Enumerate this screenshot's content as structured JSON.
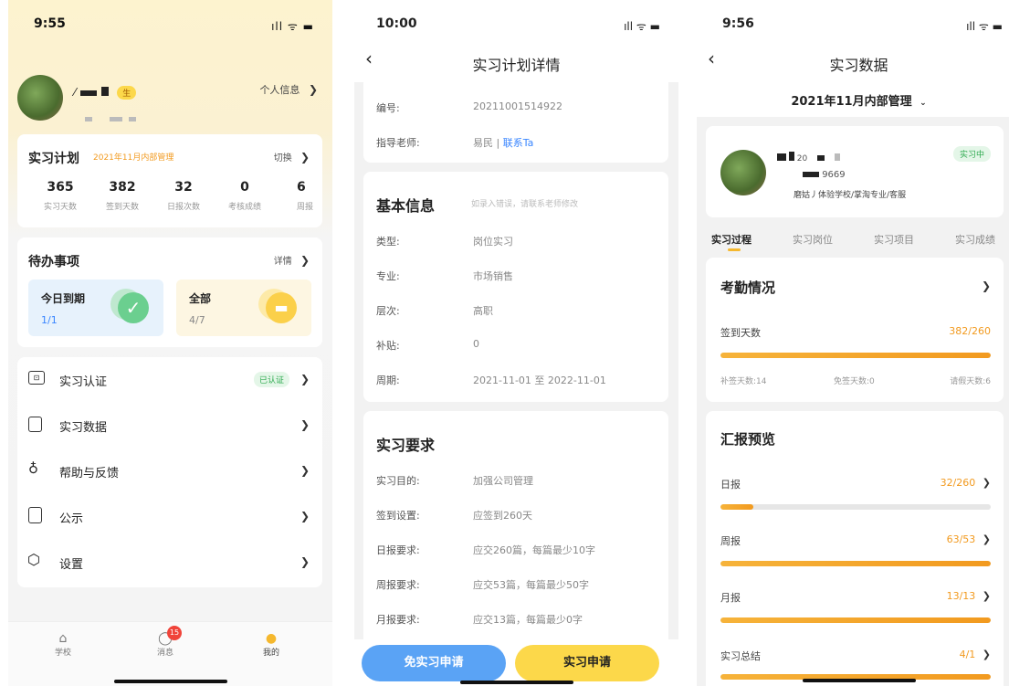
{
  "screen1": {
    "time": "9:55",
    "signal": "ıll ᯤ ▬",
    "user": {
      "name_tag": "生",
      "profile_link": "个人信息"
    },
    "plan": {
      "title": "实习计划",
      "subtitle": "2021年11月内部管理",
      "switch": "切换",
      "stats": [
        {
          "value": "365",
          "label": "实习天数"
        },
        {
          "value": "382",
          "label": "签到天数"
        },
        {
          "value": "32",
          "label": "日报次数"
        },
        {
          "value": "0",
          "label": "考核成绩"
        },
        {
          "value": "6",
          "label": "周报"
        }
      ]
    },
    "todo": {
      "title": "待办事项",
      "detail": "详情",
      "today": {
        "label": "今日到期",
        "count": "1/1"
      },
      "all": {
        "label": "全部",
        "count": "4/7"
      }
    },
    "menu": [
      {
        "label": "实习认证",
        "badge": "已认证"
      },
      {
        "label": "实习数据"
      },
      {
        "label": "帮助与反馈"
      },
      {
        "label": "公示"
      },
      {
        "label": "设置"
      }
    ],
    "tabbar": {
      "school": "学校",
      "messages": "消息",
      "badge": "15",
      "mine": "我的"
    }
  },
  "screen2": {
    "time": "10:00",
    "signal": "ıll ᯤ ▬",
    "title": "实习计划详情",
    "top": {
      "number_label": "编号:",
      "number": "20211001514922",
      "teacher_label": "指导老师:",
      "teacher": "易民 | ",
      "contact": "联系Ta"
    },
    "basic": {
      "title": "基本信息",
      "hint": "如录入错误，请联系老师修改",
      "rows": [
        {
          "label": "类型:",
          "value": "岗位实习"
        },
        {
          "label": "专业:",
          "value": "市场销售"
        },
        {
          "label": "层次:",
          "value": "高职"
        },
        {
          "label": "补贴:",
          "value": "0"
        },
        {
          "label": "周期:",
          "value": "2021-11-01 至 2022-11-01"
        }
      ]
    },
    "req": {
      "title": "实习要求",
      "rows": [
        {
          "label": "实习目的:",
          "value": "加强公司管理"
        },
        {
          "label": "签到设置:",
          "value": "应签到260天"
        },
        {
          "label": "日报要求:",
          "value": "应交260篇，每篇最少10字"
        },
        {
          "label": "周报要求:",
          "value": "应交53篇，每篇最少50字"
        },
        {
          "label": "月报要求:",
          "value": "应交13篇，每篇最少0字"
        }
      ]
    },
    "buttons": {
      "exempt": "免实习申请",
      "apply": "实习申请"
    }
  },
  "screen3": {
    "time": "9:56",
    "signal": "ıll ᯤ ▬",
    "title": "实习数据",
    "plan_select": "2021年11月内部管理",
    "profile": {
      "status": "实习中",
      "id_tail": "9669",
      "school": "磨姑丿体验学校/掌淘专业/客服",
      "code_frag": "20"
    },
    "tabs": [
      "实习过程",
      "实习岗位",
      "实习项目",
      "实习成绩"
    ],
    "attendance": {
      "title": "考勤情况",
      "label": "签到天数",
      "value": "382/260",
      "progress": 1.0,
      "makeup": "补签天数:14",
      "exempt": "免签天数:0",
      "leave": "请假天数:6"
    },
    "reports": {
      "title": "汇报预览",
      "items": [
        {
          "label": "日报",
          "value": "32/260",
          "progress": 0.12
        },
        {
          "label": "周报",
          "value": "63/53",
          "progress": 1.0
        },
        {
          "label": "月报",
          "value": "13/13",
          "progress": 1.0
        },
        {
          "label": "实习总结",
          "value": "4/1",
          "progress": 1.0
        }
      ]
    }
  },
  "colors": {
    "accent": "#f29a1f",
    "link": "#3a86ff",
    "green": "#4caf50",
    "yellow": "#fcd84a",
    "blue_button": "#5aa3f5"
  }
}
